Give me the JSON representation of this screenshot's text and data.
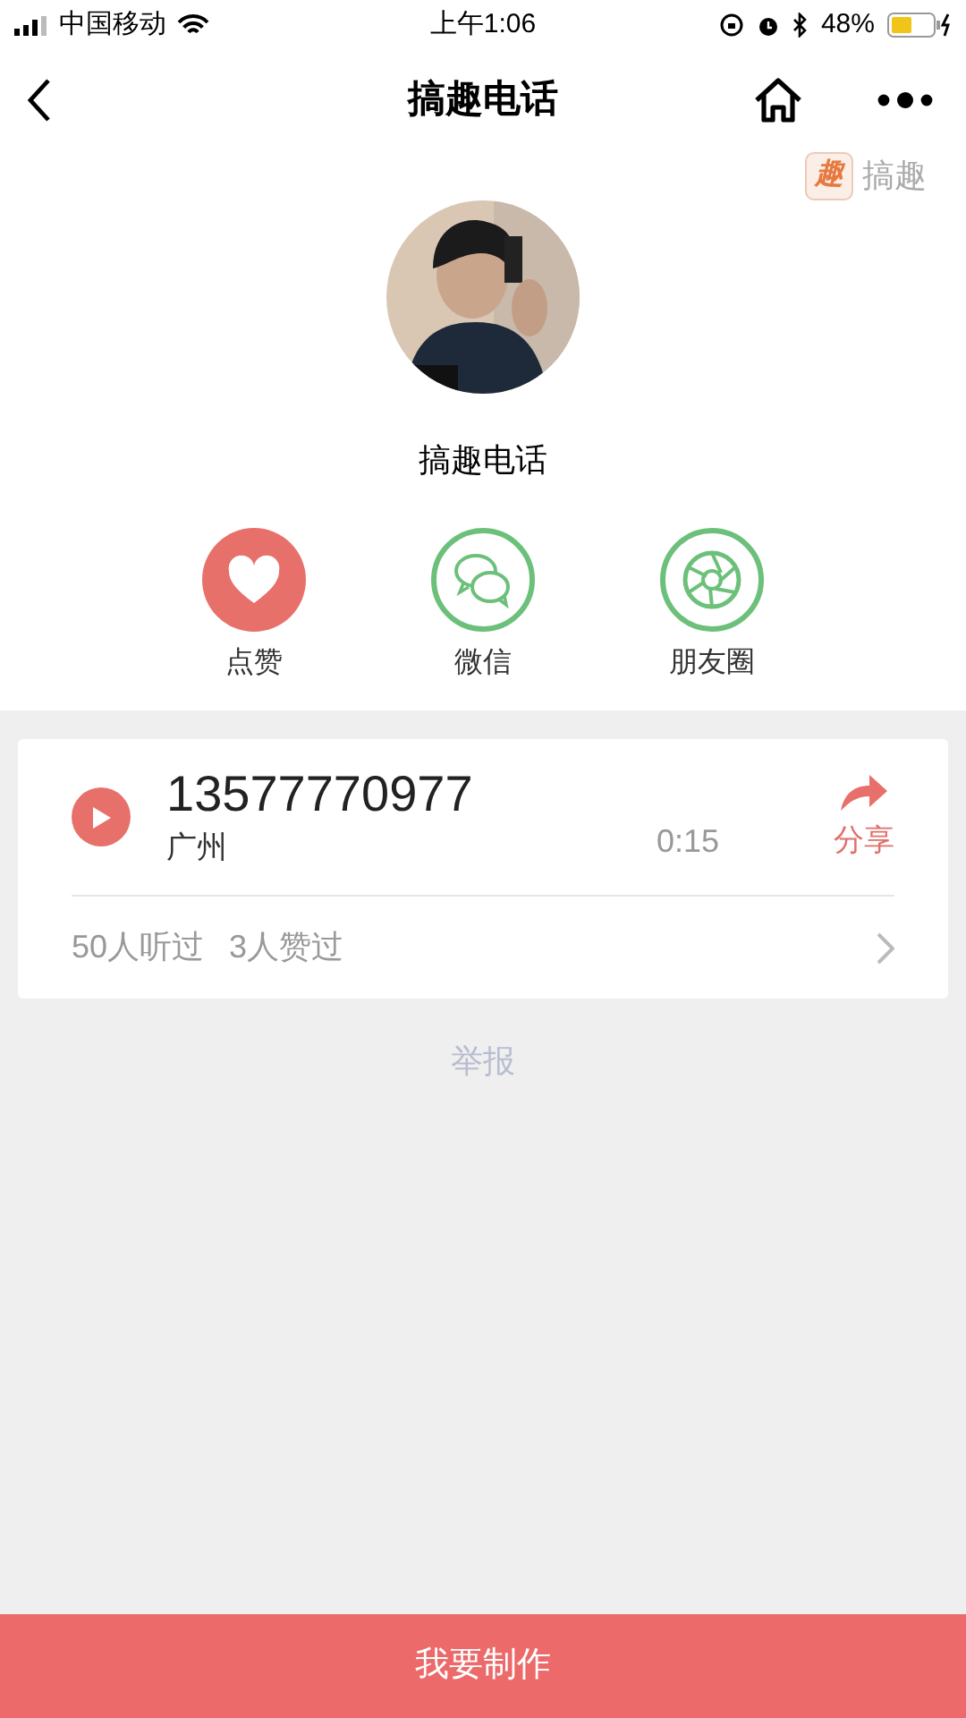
{
  "status_bar": {
    "carrier": "中国移动",
    "time": "上午1:06",
    "battery": "48%"
  },
  "nav": {
    "title": "搞趣电话"
  },
  "brand_badge": {
    "mark": "趣",
    "label": "搞趣"
  },
  "profile": {
    "name": "搞趣电话"
  },
  "actions": [
    {
      "kind": "like",
      "label": "点赞"
    },
    {
      "kind": "wechat",
      "label": "微信"
    },
    {
      "kind": "moments",
      "label": "朋友圈"
    }
  ],
  "recording": {
    "phone": "13577770977",
    "city": "广州",
    "duration": "0:15",
    "share": "分享",
    "stats": [
      "50人听过",
      "3人赞过"
    ]
  },
  "report": "举报",
  "make_button": "我要制作"
}
